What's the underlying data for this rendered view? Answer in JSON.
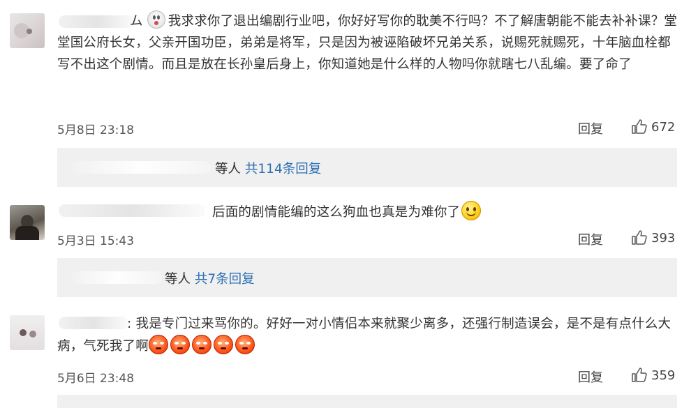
{
  "comments": [
    {
      "prefix": "ム",
      "text": "我求求你了退出编剧行业吧，你好好写你的耽美不行吗？不了解唐朝能不能去补补课？堂堂国公府长女，父亲开国功臣，弟弟是将军，只是因为被诬陷破坏兄弟关系，说赐死就赐死，十年脑血栓都写不出这个剧情。而且是放在长孙皇后身上，你知道她是什么样的人物吗你就瞎七八乱编。要了命了",
      "time": "5月8日 23:18",
      "reply_label": "回复",
      "likes": "672",
      "replies_panel": {
        "suffix": "等人",
        "link": "共114条回复"
      }
    },
    {
      "prefix": "",
      "text": "后面的剧情能编的这么狗血也真是为难你了",
      "emoji": "smile-emoji",
      "time": "5月3日 15:43",
      "reply_label": "回复",
      "likes": "393",
      "replies_panel": {
        "suffix": "等人",
        "link": "共7条回复"
      }
    },
    {
      "prefix": ":",
      "text": "我是专门过来骂你的。好好一对小情侣本来就聚少离多，还强行制造误会，是不是有点什么大病，气死我了啊",
      "emoji": "angry-emoji",
      "emoji_count": 5,
      "time": "5月6日 23:48",
      "reply_label": "回复",
      "likes": "359"
    }
  ],
  "colors": {
    "link": "#2e6fb3",
    "panel_bg": "#f0f0f0",
    "text": "#333333"
  }
}
